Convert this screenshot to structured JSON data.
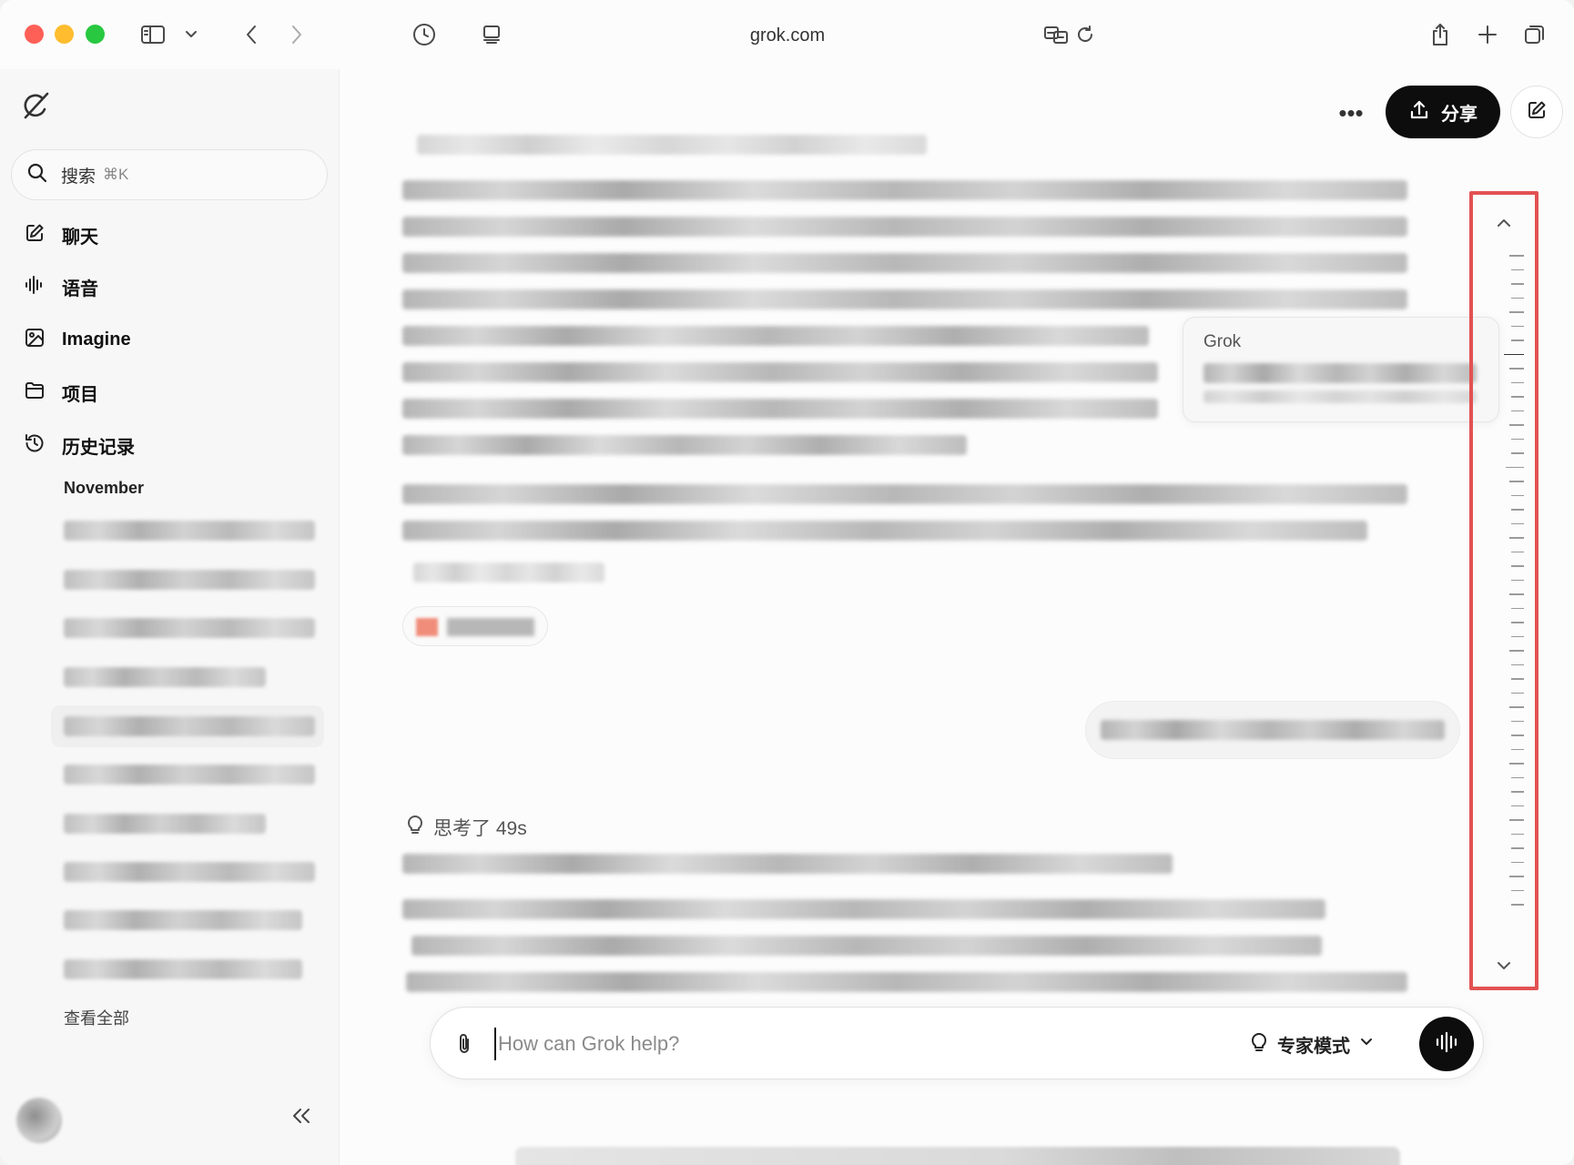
{
  "browser": {
    "url": "grok.com"
  },
  "sidebar": {
    "search": {
      "label": "搜索",
      "shortcut": "⌘K"
    },
    "nav": [
      {
        "label": "聊天",
        "icon": "edit-icon"
      },
      {
        "label": "语音",
        "icon": "waveform-icon"
      },
      {
        "label": "Imagine",
        "icon": "image-icon"
      },
      {
        "label": "项目",
        "icon": "folder-icon"
      },
      {
        "label": "历史记录",
        "icon": "history-icon"
      }
    ],
    "history_group": "November",
    "view_all": "查看全部"
  },
  "main": {
    "share_label": "分享",
    "tooltip_title": "Grok",
    "thought_label": "思考了 49s",
    "composer": {
      "placeholder": "How can Grok help?",
      "mode_label": "专家模式"
    }
  },
  "colors": {
    "highlight_border": "#e25252",
    "dark_button": "#0d0d0d"
  }
}
